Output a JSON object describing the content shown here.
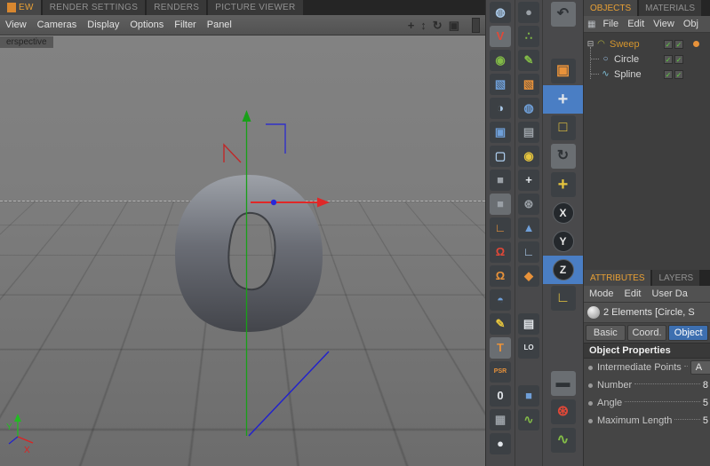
{
  "colors": {
    "accent_orange": "#e8a035",
    "selection_blue": "#4a7ec4",
    "axis_x_red": "#e02828",
    "axis_y_green": "#18a018",
    "axis_z_blue": "#2828d8",
    "viewport_gray": "#7d7d7d"
  },
  "layout_tabs": {
    "items": [
      {
        "label": "EW",
        "active": true
      },
      {
        "label": "RENDER SETTINGS",
        "active": false
      },
      {
        "label": "RENDERS",
        "active": false
      },
      {
        "label": "PICTURE VIEWER",
        "active": false
      }
    ]
  },
  "viewport": {
    "menu": [
      "View",
      "Cameras",
      "Display",
      "Options",
      "Filter",
      "Panel"
    ],
    "nav_icons": [
      {
        "name": "pan-view-icon",
        "glyph": "+"
      },
      {
        "name": "zoom-view-icon",
        "glyph": "↕"
      },
      {
        "name": "rotate-view-icon",
        "glyph": "↻"
      },
      {
        "name": "maximize-view-icon",
        "glyph": "▣"
      }
    ],
    "camera_label": "erspective",
    "axis_labels": {
      "y": "Y",
      "x": "X"
    }
  },
  "toolbars": {
    "col_a": [
      {
        "name": "content-browser-icon",
        "glyph": "◍"
      },
      {
        "name": "viewport-v-icon",
        "glyph": "V"
      },
      {
        "name": "point-sphere-icon",
        "glyph": "◉"
      },
      {
        "name": "cube-primitive-icon",
        "glyph": "▧"
      },
      {
        "name": "checker-sphere-icon",
        "glyph": "◑"
      },
      {
        "name": "array-cubes-icon",
        "glyph": "▣"
      },
      {
        "name": "wire-cube-icon",
        "glyph": "▢"
      },
      {
        "name": "dark-cube-icon",
        "glyph": "■"
      },
      {
        "name": "instance-cube-icon",
        "glyph": "■"
      },
      {
        "name": "workplane-icon",
        "glyph": "∟"
      },
      {
        "name": "magnet-icon",
        "glyph": "Ω"
      },
      {
        "name": "snap-magnet-icon",
        "glyph": "Ω"
      },
      {
        "name": "dome-icon",
        "glyph": "◓"
      },
      {
        "name": "spline-pen-icon",
        "glyph": "✎"
      },
      {
        "name": "text-spline-icon",
        "glyph": "T"
      },
      {
        "name": "psr-icon",
        "glyph": "PSR"
      },
      {
        "name": "zero-icon",
        "glyph": "0"
      },
      {
        "name": "grid-array-icon",
        "glyph": "▦"
      },
      {
        "name": "sphere-icon",
        "glyph": "●"
      }
    ],
    "col_b": [
      {
        "name": "model-mode-icon",
        "glyph": "●"
      },
      {
        "name": "points-mode-icon",
        "glyph": "∴"
      },
      {
        "name": "pen-icon",
        "glyph": "✎"
      },
      {
        "name": "polygon-mode-icon",
        "glyph": "▧"
      },
      {
        "name": "texture-globe-icon",
        "glyph": "◍"
      },
      {
        "name": "film-camera-icon",
        "glyph": "▤"
      },
      {
        "name": "light-icon",
        "glyph": "◉"
      },
      {
        "name": "axis-mode-icon",
        "glyph": "+"
      },
      {
        "name": "gear-icon",
        "glyph": "⊛"
      },
      {
        "name": "pyramid-icon",
        "glyph": "▲"
      },
      {
        "name": "ruler-icon",
        "glyph": "∟"
      },
      {
        "name": "marker-icon",
        "glyph": "◆"
      },
      {
        "name": "document-icon",
        "glyph": "▤"
      },
      {
        "name": "lo-render-icon",
        "glyph": "LO"
      },
      {
        "name": "blue-cube-icon",
        "glyph": "■"
      },
      {
        "name": "spline-wave-icon",
        "glyph": "∿"
      }
    ],
    "col_c": [
      {
        "name": "undo-icon",
        "glyph": "↶"
      },
      {
        "name": "spacer",
        "glyph": ""
      },
      {
        "name": "render-region-icon",
        "glyph": "▣"
      },
      {
        "name": "move-tool-icon",
        "glyph": "+",
        "active": true
      },
      {
        "name": "scale-tool-icon",
        "glyph": "□"
      },
      {
        "name": "rotate-tool-icon",
        "glyph": "↻"
      },
      {
        "name": "axis-cross-icon",
        "glyph": "+"
      },
      {
        "name": "x-lock-button",
        "glyph": "X"
      },
      {
        "name": "y-lock-button",
        "glyph": "Y"
      },
      {
        "name": "z-lock-button",
        "glyph": "Z",
        "active": true
      },
      {
        "name": "coord-system-icon",
        "glyph": "∟"
      },
      {
        "name": "spacer",
        "glyph": ""
      },
      {
        "name": "spacer",
        "glyph": ""
      },
      {
        "name": "clapperboard-icon",
        "glyph": "▬"
      },
      {
        "name": "red-gear-icon",
        "glyph": "⊛"
      },
      {
        "name": "spline-live-icon",
        "glyph": "∿"
      }
    ]
  },
  "objects_panel": {
    "tabs": [
      {
        "label": "OBJECTS",
        "active": true
      },
      {
        "label": "MATERIALS",
        "active": false
      }
    ],
    "menu_icon": "▦",
    "menu": [
      "File",
      "Edit",
      "View",
      "Obj"
    ],
    "tree": {
      "expander": "⊟",
      "check": "✓",
      "rows": [
        {
          "label": "Sweep",
          "glyph": "◠",
          "selected": true
        },
        {
          "label": "Circle",
          "glyph": "○"
        },
        {
          "label": "Spline",
          "glyph": "∿"
        }
      ]
    }
  },
  "attributes_panel": {
    "tabs": [
      {
        "label": "ATTRIBUTES",
        "active": true
      },
      {
        "label": "LAYERS",
        "active": false
      }
    ],
    "menu": [
      "Mode",
      "Edit",
      "User Da"
    ],
    "selection": "2 Elements [Circle, S",
    "section_tabs": [
      {
        "label": "Basic",
        "active": false
      },
      {
        "label": "Coord.",
        "active": false
      },
      {
        "label": "Object",
        "active": true
      }
    ],
    "properties_title": "Object Properties",
    "properties": [
      {
        "label": "Intermediate Points",
        "value": "A"
      },
      {
        "label": "Number",
        "value": "8"
      },
      {
        "label": "Angle",
        "value": "5"
      },
      {
        "label": "Maximum Length",
        "value": "5"
      }
    ]
  }
}
